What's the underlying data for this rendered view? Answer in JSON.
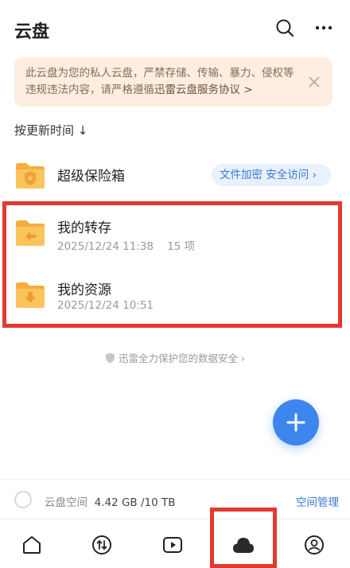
{
  "header": {
    "title": "云盘"
  },
  "notice": {
    "text": "此云盘为您的私人云盘，严禁存储、传输、暴力、侵权等违规违法内容，请严格遵循",
    "link_text": "迅雷云盘服务协议 >"
  },
  "sort": {
    "label": "按更新时间 ↓"
  },
  "vault": {
    "title": "超级保险箱",
    "badge": "文件加密 安全访问 ›"
  },
  "folders": [
    {
      "title": "我的转存",
      "date": "2025/12/24 11:38",
      "count": "15 项"
    },
    {
      "title": "我的资源",
      "date": "2025/12/24 10:51",
      "count": ""
    }
  ],
  "protect": {
    "text": "迅雷全力保护您的数据安全 ›"
  },
  "storage": {
    "label": "云盘空间",
    "used": "4.42 GB /10 TB",
    "manage": "空间管理"
  },
  "colors": {
    "accent": "#3d86ee",
    "folder": "#f7b84b",
    "highlight": "#e23a2e",
    "notice_bg": "#fdeee1"
  }
}
